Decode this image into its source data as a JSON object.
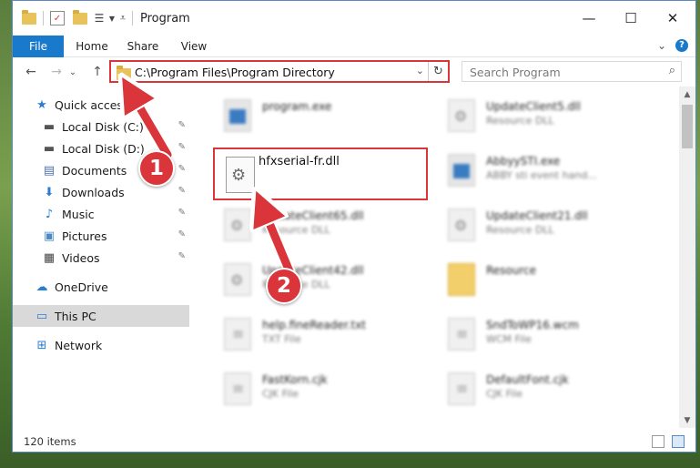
{
  "window": {
    "title": "Program",
    "controls": {
      "minimize": "—",
      "maximize": "☐",
      "close": "✕"
    }
  },
  "ribbon": {
    "tabs": [
      "File",
      "Home",
      "Share",
      "View"
    ],
    "expand": "⌄",
    "help": "?"
  },
  "address": {
    "path": "C:\\Program Files\\Program Directory",
    "dropdown": "⌄",
    "refresh": "↻"
  },
  "search": {
    "placeholder": "Search Program"
  },
  "nav_buttons": {
    "back": "←",
    "forward": "→",
    "recent": "⌄",
    "up": "↑"
  },
  "sidebar": {
    "items": [
      {
        "label": "Quick access",
        "icon": "★",
        "pinned": false,
        "selected": false,
        "icon_color": "#2b7cd3"
      },
      {
        "label": "Local Disk (C:)",
        "icon": "▬",
        "pinned": true,
        "selected": false,
        "icon_color": "#555555"
      },
      {
        "label": "Local Disk (D:)",
        "icon": "▬",
        "pinned": true,
        "selected": false,
        "icon_color": "#555555"
      },
      {
        "label": "Documents",
        "icon": "▤",
        "pinned": true,
        "selected": false,
        "icon_color": "#4b6fa8"
      },
      {
        "label": "Downloads",
        "icon": "⬇",
        "pinned": true,
        "selected": false,
        "icon_color": "#2b7cd3"
      },
      {
        "label": "Music",
        "icon": "♪",
        "pinned": true,
        "selected": false,
        "icon_color": "#2b7cd3"
      },
      {
        "label": "Pictures",
        "icon": "▣",
        "pinned": true,
        "selected": false,
        "icon_color": "#4b8ac9"
      },
      {
        "label": "Videos",
        "icon": "▦",
        "pinned": true,
        "selected": false,
        "icon_color": "#444444"
      },
      {
        "label": "OneDrive",
        "icon": "☁",
        "pinned": false,
        "selected": false,
        "icon_color": "#2b7cd3"
      },
      {
        "label": "This PC",
        "icon": "▭",
        "pinned": false,
        "selected": true,
        "icon_color": "#2b7cd3"
      },
      {
        "label": "Network",
        "icon": "⊞",
        "pinned": false,
        "selected": false,
        "icon_color": "#2b7cd3"
      }
    ],
    "pin_glyph": "✎"
  },
  "files": [
    {
      "name": "program.exe",
      "desc": "",
      "icon": "exe"
    },
    {
      "name": "UpdateClient5.dll",
      "desc": "Resource DLL",
      "icon": "gear"
    },
    {
      "name": "AbbyySTI.exe",
      "desc": "ABBY sti event hand...",
      "icon": "exe"
    },
    {
      "name": "UpdateClient65.dll",
      "desc": "Resource DLL",
      "icon": "gear"
    },
    {
      "name": "UpdateClient21.dll",
      "desc": "Resource DLL",
      "icon": "gear"
    },
    {
      "name": "UpdateClient42.dll",
      "desc": "Resource DLL",
      "icon": "gear"
    },
    {
      "name": "Resource",
      "desc": "",
      "icon": "folder"
    },
    {
      "name": "help.fineReader.txt",
      "desc": "TXT File",
      "icon": "txt"
    },
    {
      "name": "SndToWP16.wcm",
      "desc": "WCM File",
      "icon": "txt"
    },
    {
      "name": "FastKorn.cjk",
      "desc": "CJK File",
      "icon": "txt"
    },
    {
      "name": "DefaultFont.cjk",
      "desc": "CJK File",
      "icon": "txt"
    }
  ],
  "highlighted_file": {
    "name": "hfxserial-fr.dll"
  },
  "callouts": [
    "1",
    "2"
  ],
  "status": {
    "item_count": "120 items"
  },
  "colors": {
    "accent": "#1979ca",
    "highlight": "#d9353a",
    "selected_bg": "#d9d9d9"
  }
}
